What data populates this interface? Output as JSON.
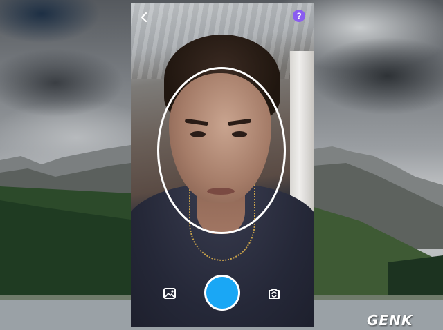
{
  "screen": {
    "help_label": "?",
    "icons": {
      "back": "chevron-left-icon",
      "help": "question-mark-icon",
      "gallery": "image-gallery-icon",
      "shutter": "capture-button",
      "switch_camera": "switch-camera-icon"
    },
    "colors": {
      "help_button": "#8a5cf0",
      "shutter": "#1aa7f5",
      "face_guide": "#ffffff"
    }
  },
  "watermark": {
    "text": "GENK"
  }
}
